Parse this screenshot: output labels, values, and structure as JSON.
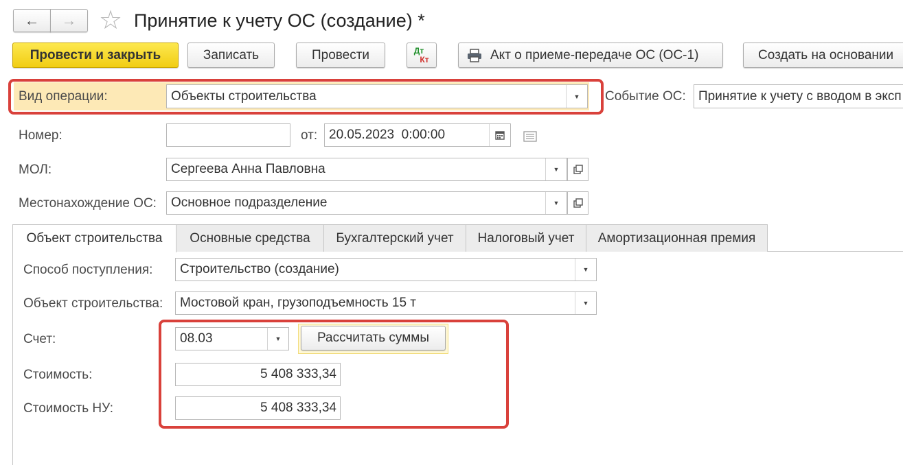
{
  "window": {
    "title": "Принятие к учету ОС (создание) *"
  },
  "nav": {
    "back_glyph": "←",
    "forward_glyph": "→",
    "star_glyph": "☆"
  },
  "toolbar": {
    "post_close": "Провести и закрыть",
    "save": "Записать",
    "post": "Провести",
    "dtkt_top": "Дт",
    "dtkt_bottom": "Кт",
    "print_act": "Акт о приеме-передаче ОС (ОС-1)",
    "create_based": "Создать на основании"
  },
  "header": {
    "operation_label": "Вид операции:",
    "operation_value": "Объекты строительства",
    "event_label": "Событие ОС:",
    "event_value": "Принятие к учету с вводом в эксп",
    "number_label": "Номер:",
    "number_value": "",
    "date_label": "от:",
    "date_value": "20.05.2023  0:00:00",
    "mol_label": "МОЛ:",
    "mol_value": "Сергеева Анна Павловна",
    "location_label": "Местонахождение ОС:",
    "location_value": "Основное подразделение"
  },
  "tabs": [
    {
      "label": "Объект строительства",
      "active": true
    },
    {
      "label": "Основные средства",
      "active": false
    },
    {
      "label": "Бухгалтерский учет",
      "active": false
    },
    {
      "label": "Налоговый учет",
      "active": false
    },
    {
      "label": "Амортизационная премия",
      "active": false
    }
  ],
  "panel": {
    "receipt_label": "Способ поступления:",
    "receipt_value": "Строительство (создание)",
    "object_label": "Объект строительства:",
    "object_value": "Мостовой кран, грузоподъемность 15 т",
    "account_label": "Счет:",
    "account_value": "08.03",
    "calc_button": "Рассчитать суммы",
    "cost_label": "Стоимость:",
    "cost_value": "5 408 333,34",
    "cost_tax_label": "Стоимость НУ:",
    "cost_tax_value": "5 408 333,34"
  },
  "colors": {
    "primary_button": "#f5d52a",
    "highlight_row": "#fde9b6",
    "callout_border": "#d9413b"
  }
}
